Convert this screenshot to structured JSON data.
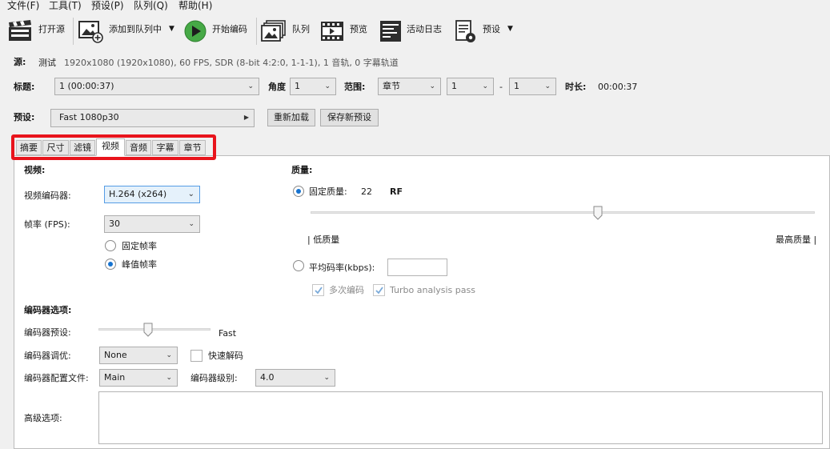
{
  "menu": {
    "file": "文件(F)",
    "tools": "工具(T)",
    "presets": "预设(P)",
    "queue": "队列(Q)",
    "help": "帮助(H)"
  },
  "toolbar": {
    "open_source": "打开源",
    "add_to_queue": "添加到队列中",
    "start_encode": "开始编码",
    "queue": "队列",
    "preview": "预览",
    "activity_log": "活动日志",
    "presets": "预设"
  },
  "source": {
    "label": "源:",
    "name": "测试",
    "info": "1920x1080 (1920x1080), 60 FPS, SDR (8-bit 4:2:0, 1-1-1), 1 音轨, 0 字幕轨道"
  },
  "title_row": {
    "title_label": "标题:",
    "title_value": "1 (00:00:37)",
    "angle_label": "角度",
    "angle_value": "1",
    "range_label": "范围:",
    "range_type": "章节",
    "range_start": "1",
    "range_dash": "-",
    "range_end": "1",
    "duration_label": "时长:",
    "duration_value": "00:00:37"
  },
  "preset_row": {
    "label": "预设:",
    "value": "Fast 1080p30",
    "reload": "重新加载",
    "save_new": "保存新预设"
  },
  "tabs": [
    "摘要",
    "尺寸",
    "滤镜",
    "视频",
    "音频",
    "字幕",
    "章节"
  ],
  "active_tab": "视频",
  "video": {
    "section_title": "视频:",
    "encoder_label": "视频编码器:",
    "encoder_value": "H.264 (x264)",
    "fps_label": "帧率 (FPS):",
    "fps_value": "30",
    "constant_fps": "固定帧率",
    "peak_fps": "峰值帧率",
    "peak_fps_selected": true
  },
  "quality": {
    "section_title": "质量:",
    "constant_quality": "固定质量:",
    "rf_value": "22",
    "rf_label": "RF",
    "low_quality": "| 低质量",
    "high_quality": "最高质量 |",
    "slider_fraction": 0.57,
    "avg_bitrate": "平均码率(kbps):",
    "avg_bitrate_value": "",
    "multipass": "多次编码",
    "turbo": "Turbo analysis pass",
    "multipass_checked": true,
    "turbo_checked": true
  },
  "encoder_options": {
    "section_title": "编码器选项:",
    "preset_label": "编码器预设:",
    "preset_value": "Fast",
    "preset_fraction": 0.44,
    "tune_label": "编码器调优:",
    "tune_value": "None",
    "fast_decode": "快速解码",
    "profile_label": "编码器配置文件:",
    "profile_value": "Main",
    "level_label": "编码器级别:",
    "level_value": "4.0",
    "advanced_label": "高级选项:",
    "advanced_value": ""
  },
  "colors": {
    "highlight": "#e8141c",
    "accent": "#1673d0",
    "start_green": "#3aa63a"
  }
}
